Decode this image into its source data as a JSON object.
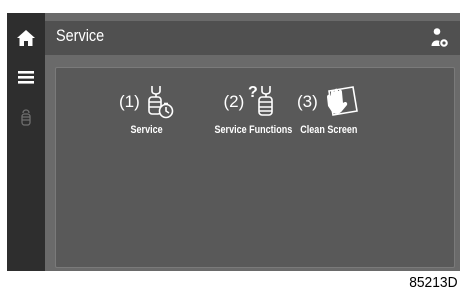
{
  "header": {
    "title": "Service"
  },
  "sidebar": {
    "items": [
      {
        "icon": "home-icon"
      },
      {
        "icon": "menu-icon"
      },
      {
        "icon": "service-hand-icon"
      }
    ]
  },
  "tiles": [
    {
      "number": "(1)",
      "label": "Service",
      "icon": "service-wrench-timer-icon"
    },
    {
      "number": "(2)",
      "label": "Service Functions",
      "icon": "service-functions-icon"
    },
    {
      "number": "(3)",
      "label": "Clean Screen",
      "icon": "clean-screen-icon"
    }
  ],
  "figure_code": "85213D",
  "colors": {
    "screen_bg": "#6a6a6a",
    "rail_bg": "#2e2e2e",
    "titlebar_bg": "#505050",
    "panel_bg": "#595959",
    "text": "#ffffff"
  }
}
